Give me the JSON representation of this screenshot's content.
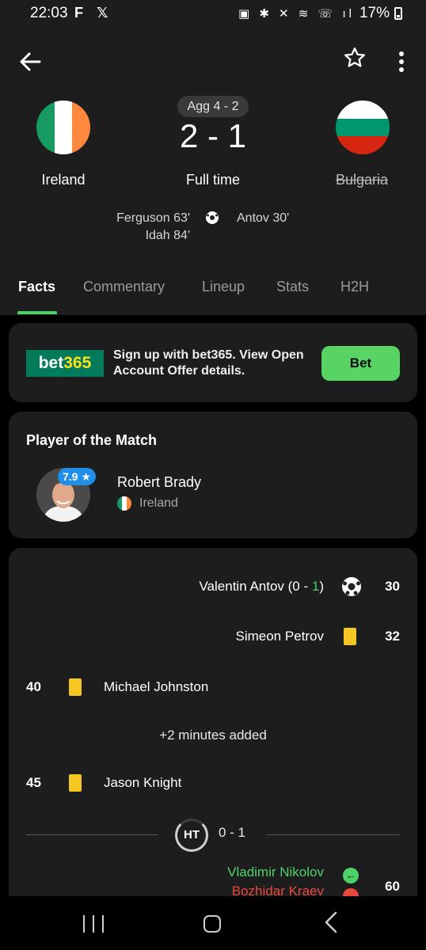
{
  "status_bar": {
    "time": "22:03",
    "notification_icons": "F 𝕏",
    "system_icons": "▣ ✱ ✕ ≋ ☏ ıl",
    "battery": "17%"
  },
  "app_bar": {
    "back_icon": "arrow-left-icon",
    "favorite_icon": "star-outline-icon",
    "more_icon": "more-vertical-icon"
  },
  "match": {
    "aggregate": "Agg 4 - 2",
    "score": "2 - 1",
    "status": "Full time",
    "home": {
      "name": "Ireland",
      "flag_colors": [
        "#169b62",
        "#ffffff",
        "#ff883e"
      ]
    },
    "away": {
      "name": "Bulgaria",
      "flag_colors": [
        "#ffffff",
        "#00966e",
        "#d62612"
      ]
    },
    "home_scorers": [
      "Ferguson 63'",
      "Idah 84'"
    ],
    "away_scorers": [
      "Antov 30'"
    ]
  },
  "tabs": [
    {
      "label": "Facts",
      "active": true
    },
    {
      "label": "Commentary",
      "active": false
    },
    {
      "label": "Lineup",
      "active": false
    },
    {
      "label": "Stats",
      "active": false
    },
    {
      "label": "H2H",
      "active": false
    }
  ],
  "ad": {
    "logo_text": "bet",
    "logo_accent": "365",
    "text": "Sign up with bet365. View Open Account Offer details.",
    "button_label": "Bet"
  },
  "player_of_match": {
    "title": "Player of the Match",
    "rating": "7.9 ★",
    "name": "Robert Brady",
    "team": "Ireland"
  },
  "events": {
    "goal": {
      "player": "Valentin Antov (0 - ",
      "score_highlight": "1",
      "score_end": ")",
      "minute": "30"
    },
    "card1": {
      "player": "Simeon Petrov",
      "minute": "32"
    },
    "card2": {
      "player": "Michael Johnston",
      "minute": "40"
    },
    "added_time": "+2 minutes added",
    "card3": {
      "player": "Jason Knight",
      "minute": "45"
    },
    "halftime": {
      "label": "HT",
      "score": "0 - 1"
    },
    "substitution": {
      "player_in": "Vladimir Nikolov",
      "player_out": "Bozhidar Kraev",
      "minute": "60"
    }
  },
  "colors": {
    "accent_green": "#48d468",
    "card_bg": "#1d1d1d",
    "yellow_card": "#f6c722",
    "sub_in": "#4fd16a",
    "sub_out": "#e9493d"
  }
}
